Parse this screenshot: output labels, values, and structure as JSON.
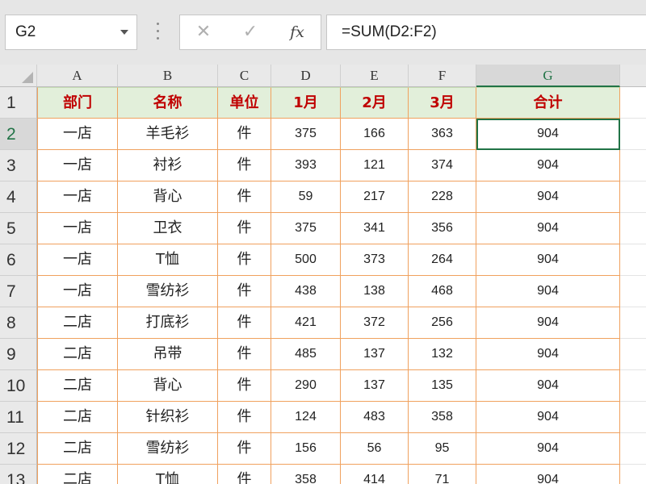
{
  "formula_bar": {
    "name_box": "G2",
    "cancel_glyph": "✕",
    "enter_glyph": "✓",
    "fx_glyph": "fx",
    "formula": "=SUM(D2:F2)"
  },
  "sheet": {
    "columns": [
      "A",
      "B",
      "C",
      "D",
      "E",
      "F",
      "G"
    ],
    "active_column": "G",
    "active_row": 2,
    "header_row": [
      "部门",
      "名称",
      "单位",
      "1月",
      "2月",
      "3月",
      "合计"
    ],
    "rows": [
      [
        "一店",
        "羊毛衫",
        "件",
        "375",
        "166",
        "363",
        "904"
      ],
      [
        "一店",
        "衬衫",
        "件",
        "393",
        "121",
        "374",
        "904"
      ],
      [
        "一店",
        "背心",
        "件",
        "59",
        "217",
        "228",
        "904"
      ],
      [
        "一店",
        "卫衣",
        "件",
        "375",
        "341",
        "356",
        "904"
      ],
      [
        "一店",
        "T恤",
        "件",
        "500",
        "373",
        "264",
        "904"
      ],
      [
        "一店",
        "雪纺衫",
        "件",
        "438",
        "138",
        "468",
        "904"
      ],
      [
        "二店",
        "打底衫",
        "件",
        "421",
        "372",
        "256",
        "904"
      ],
      [
        "二店",
        "吊带",
        "件",
        "485",
        "137",
        "132",
        "904"
      ],
      [
        "二店",
        "背心",
        "件",
        "290",
        "137",
        "135",
        "904"
      ],
      [
        "二店",
        "针织衫",
        "件",
        "124",
        "483",
        "358",
        "904"
      ],
      [
        "二店",
        "雪纺衫",
        "件",
        "156",
        "56",
        "95",
        "904"
      ],
      [
        "二店",
        "T恤",
        "件",
        "358",
        "414",
        "71",
        "904"
      ]
    ]
  },
  "colors": {
    "header_fill": "#e2efda",
    "header_text": "#c00000",
    "cell_border": "#f0a15e",
    "selection": "#217346"
  }
}
